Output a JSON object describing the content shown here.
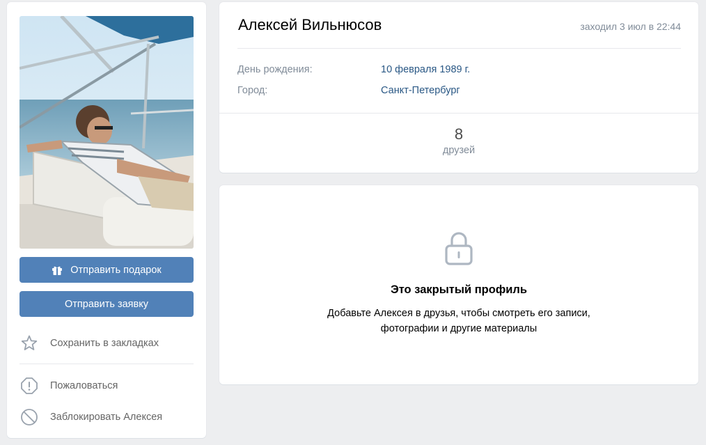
{
  "profile": {
    "name": "Алексей Вильнюсов",
    "last_seen": "заходил 3 июл в 22:44",
    "info": [
      {
        "label": "День рождения:",
        "value": "10 февраля 1989 г."
      },
      {
        "label": "Город:",
        "value": "Санкт-Петербург"
      }
    ],
    "friends": {
      "count": "8",
      "label": "друзей"
    }
  },
  "actions": {
    "send_gift": "Отправить подарок",
    "send_request": "Отправить заявку",
    "bookmark": "Сохранить в закладках",
    "report": "Пожаловаться",
    "block": "Заблокировать Алексея"
  },
  "private": {
    "title": "Это закрытый профиль",
    "line1": "Добавьте Алексея в друзья, чтобы смотреть его записи,",
    "line2": "фотографии и другие материалы"
  },
  "colors": {
    "button": "#5181b8",
    "link": "#2a5885",
    "muted": "#818c99",
    "background": "#edeef0"
  },
  "icons": [
    "gift-icon",
    "star-icon",
    "exclamation-icon",
    "block-icon",
    "lock-icon"
  ]
}
